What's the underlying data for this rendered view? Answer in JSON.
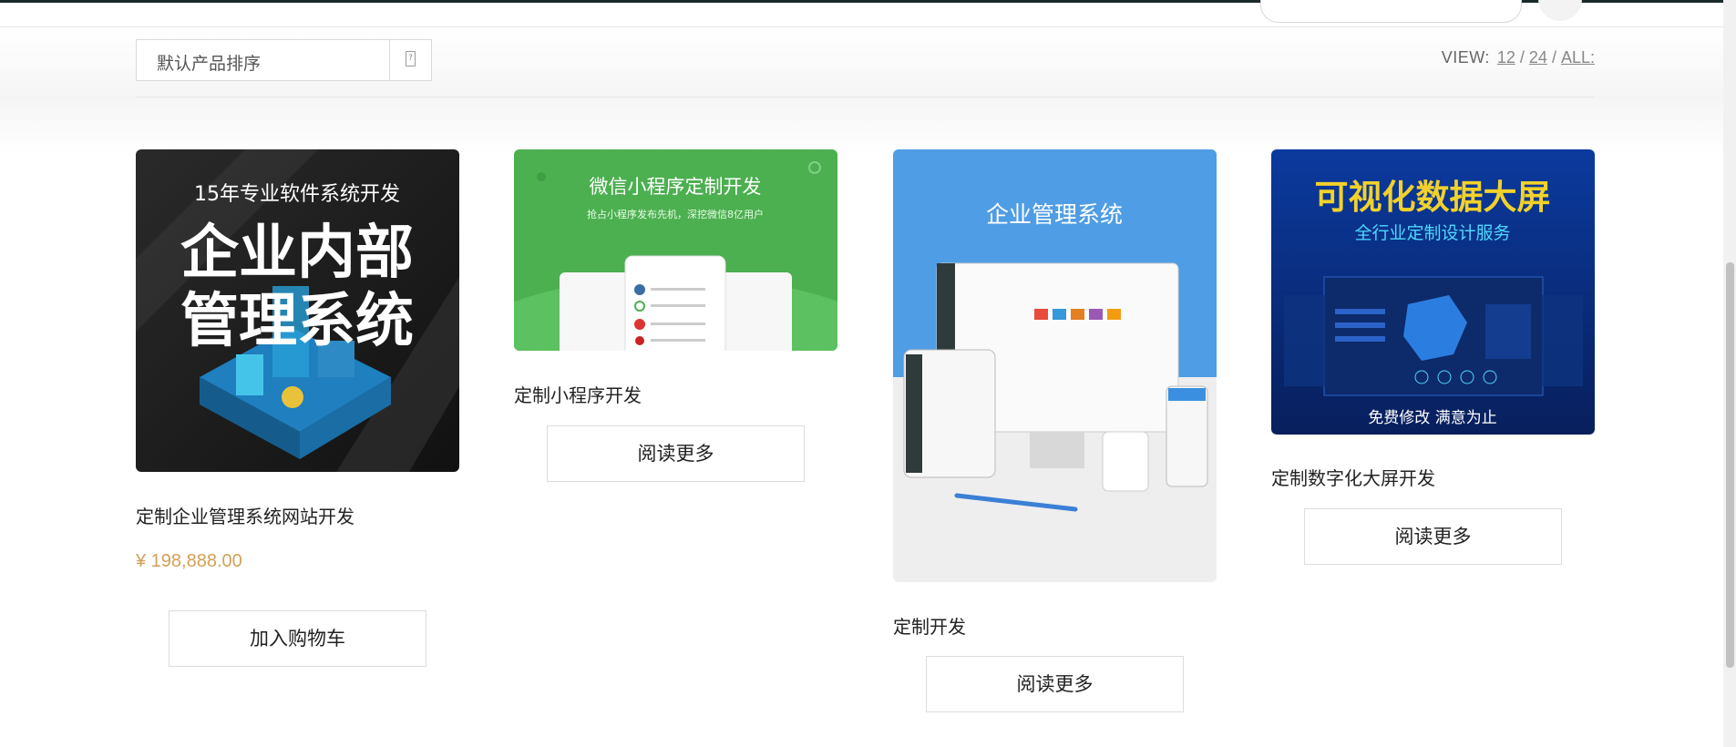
{
  "toolbar": {
    "sort_label": "默认产品排序",
    "view_label": "VIEW:",
    "view_options": [
      "12",
      "24",
      "ALL:"
    ]
  },
  "products": [
    {
      "title": "定制企业管理系统网站开发",
      "price": "¥ 198,888.00",
      "button": "加入购物车",
      "image_text": [
        "15年专业软件系统开发",
        "企业内部",
        "管理系统"
      ]
    },
    {
      "title": "定制小程序开发",
      "button": "阅读更多",
      "image_text": [
        "微信小程序定制开发",
        "抢占小程序发布先机，深挖微信8亿用户"
      ]
    },
    {
      "title": "定制开发",
      "button": "阅读更多",
      "image_text": [
        "企业管理系统"
      ]
    },
    {
      "title": "定制数字化大屏开发",
      "button": "阅读更多",
      "image_text": [
        "可视化数据大屏",
        "全行业定制设计服务",
        "免费修改  满意为止"
      ]
    }
  ],
  "colors": {
    "price": "#d4a056",
    "green_banner": "#4caf50",
    "blue_banner": "#0a2f8c"
  }
}
